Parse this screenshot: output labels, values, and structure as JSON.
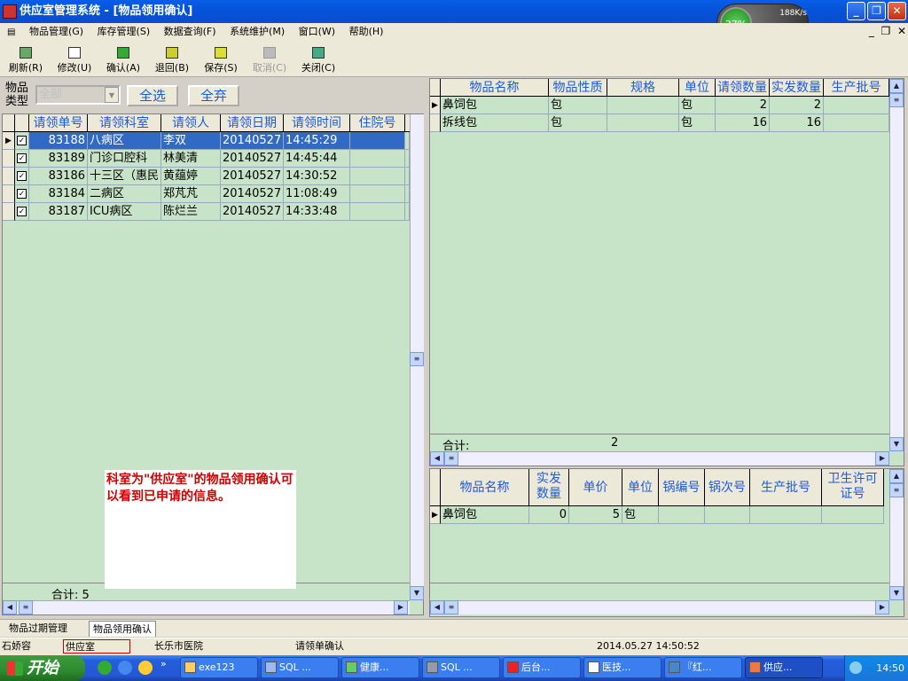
{
  "window": {
    "title": "供应室管理系统 - [物品领用确认]",
    "min": "_",
    "restore": "❐",
    "close": "✕"
  },
  "speed_widget": {
    "cpu": "37%",
    "net": "188K/s",
    "temp": "--℃"
  },
  "menu": [
    "物品管理(G)",
    "库存管理(S)",
    "数据查询(F)",
    "系统维护(M)",
    "窗口(W)",
    "帮助(H)"
  ],
  "mdi_buttons": [
    "_",
    "❐",
    "✕"
  ],
  "toolbar": [
    {
      "label": "刷新(R)",
      "icon": "refresh-icon",
      "enabled": true
    },
    {
      "label": "修改(U)",
      "icon": "edit-icon",
      "enabled": true
    },
    {
      "label": "确认(A)",
      "icon": "confirm-icon",
      "enabled": true
    },
    {
      "label": "退回(B)",
      "icon": "return-icon",
      "enabled": true
    },
    {
      "label": "保存(S)",
      "icon": "save-icon",
      "enabled": true
    },
    {
      "label": "取消(C)",
      "icon": "cancel-icon",
      "enabled": false
    },
    {
      "label": "关闭(C)",
      "icon": "close-doc-icon",
      "enabled": true
    }
  ],
  "filter": {
    "label": "物品类型",
    "value": "全部",
    "select_all": "全选",
    "deselect_all": "全弃"
  },
  "request_grid": {
    "headers": [
      "请领单号",
      "请领科室",
      "请领人",
      "请领日期",
      "请领时间",
      "住院号",
      "​"
    ],
    "rows": [
      {
        "no": "83188",
        "dept": "八病区",
        "person": "李双",
        "date": "20140527",
        "time": "14:45:29",
        "checked": true,
        "selected": true
      },
      {
        "no": "83189",
        "dept": "门诊口腔科",
        "person": "林美清",
        "date": "20140527",
        "time": "14:45:44",
        "checked": true,
        "selected": false
      },
      {
        "no": "83186",
        "dept": "十三区（惠民",
        "person": "黄蕴婷",
        "date": "20140527",
        "time": "14:30:52",
        "checked": true,
        "selected": false
      },
      {
        "no": "83184",
        "dept": "二病区",
        "person": "郑芃芃",
        "date": "20140527",
        "time": "11:08:49",
        "checked": true,
        "selected": false
      },
      {
        "no": "83187",
        "dept": "ICU病区",
        "person": "陈烂兰",
        "date": "20140527",
        "time": "14:33:48",
        "checked": true,
        "selected": false
      }
    ],
    "total_label": "合计: 5"
  },
  "note": "科室为\"供应室\"的物品领用确认可以看到已申请的信息。",
  "item_grid": {
    "headers": [
      "物品名称",
      "物品性质",
      "规格",
      "单位",
      "请领数量",
      "实发数量",
      "生产批号"
    ],
    "rows": [
      {
        "name": "鼻饲包",
        "nature": "包",
        "spec": "",
        "unit": "包",
        "req": "2",
        "issued": "2"
      },
      {
        "name": "拆线包",
        "nature": "包",
        "spec": "",
        "unit": "包",
        "req": "16",
        "issued": "16"
      }
    ],
    "total_label": "合计:",
    "total_value": "2"
  },
  "detail_grid": {
    "headers": [
      "物品名称",
      "实发\n数量",
      "单价",
      "单位",
      "锅编号",
      "锅次号",
      "生产批号",
      "卫生许可\n证号"
    ],
    "rows": [
      {
        "name": "鼻饲包",
        "issued": "0",
        "price": "5",
        "unit": "包"
      }
    ]
  },
  "tabs": [
    "物品过期管理",
    "物品领用确认"
  ],
  "status": {
    "user": "石娇容",
    "dept": "供应室",
    "hospital": "长乐市医院",
    "form": "请领单确认",
    "datetime": "2014.05.27 14:50:52"
  },
  "taskbar": {
    "start": "开始",
    "tasks": [
      "exe123",
      "SQL ...",
      "健康...",
      "SQL ...",
      "后台...",
      "医技...",
      "『红...",
      "供应..."
    ],
    "clock": "14:50"
  }
}
